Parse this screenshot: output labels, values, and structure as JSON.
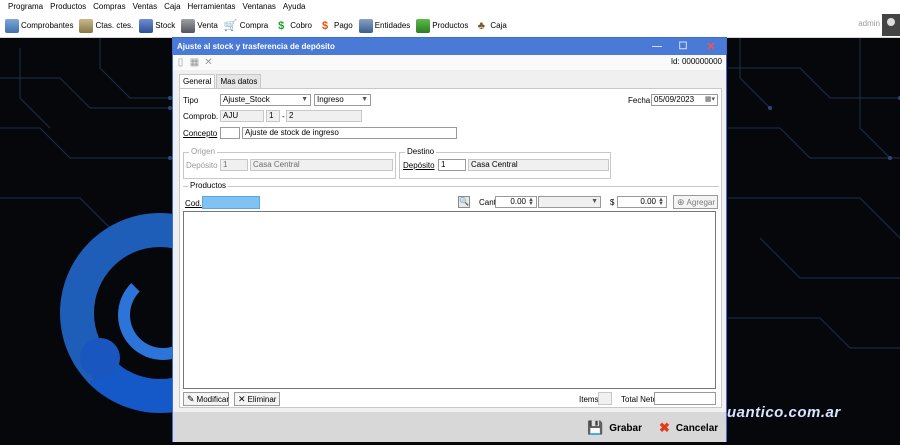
{
  "menu": [
    "Programa",
    "Productos",
    "Compras",
    "Ventas",
    "Caja",
    "Herramientas",
    "Ventanas",
    "Ayuda"
  ],
  "toolbar": [
    {
      "label": "Comprobantes",
      "icon": "comprobantes-icon"
    },
    {
      "label": "Ctas. ctes.",
      "icon": "ctas-ctes-icon"
    },
    {
      "label": "Stock",
      "icon": "stock-icon"
    },
    {
      "label": "Venta",
      "icon": "venta-icon"
    },
    {
      "label": "Compra",
      "icon": "cart-icon"
    },
    {
      "label": "Cobro",
      "icon": "cobro-icon"
    },
    {
      "label": "Pago",
      "icon": "pago-icon"
    },
    {
      "label": "Entidades",
      "icon": "entidades-icon"
    },
    {
      "label": "Productos",
      "icon": "productos-icon"
    },
    {
      "label": "Caja",
      "icon": "caja-icon"
    }
  ],
  "user": "admin",
  "background": {
    "brand": "uantico.com.ar"
  },
  "dialog": {
    "title": "Ajuste al stock y trasferencia de depósito",
    "id_label": "Id:",
    "id_value": "000000000",
    "tabs": [
      "General",
      "Mas datos"
    ],
    "tipo_label": "Tipo",
    "tipo_value": "Ajuste_Stock",
    "tipo2_value": "Ingreso",
    "fecha_label": "Fecha",
    "fecha_value": "05/09/2023",
    "comprob_label": "Comprob.",
    "comprob_prefix": "AJU",
    "comprob_num1": "1",
    "comprob_sep": "-",
    "comprob_num2": "2",
    "concepto_label": "Concepto",
    "concepto_code": "",
    "concepto_value": "Ajuste de stock de ingreso",
    "origen": {
      "title": "Origen",
      "label": "Depósito",
      "code": "1",
      "name": "Casa Central"
    },
    "destino": {
      "title": "Destino",
      "label": "Depósito",
      "code": "1",
      "name": "Casa Central"
    },
    "productos": {
      "title": "Productos",
      "cod_label": "Cod.",
      "cod_value": "",
      "cant_label": "Cant.",
      "cant_value": "0.00",
      "unit_value": "",
      "price_label": "$",
      "price_value": "0.00",
      "agregar_label": "Agregar"
    },
    "modificar_label": "Modificar",
    "eliminar_label": "Eliminar",
    "items_label": "Items",
    "items_value": "",
    "total_label": "Total Neto",
    "total_value": "",
    "grabar_label": "Grabar",
    "cancelar_label": "Cancelar"
  },
  "colors": {
    "title_bar": "#4a7ad6",
    "accent": "#1e5db8"
  }
}
